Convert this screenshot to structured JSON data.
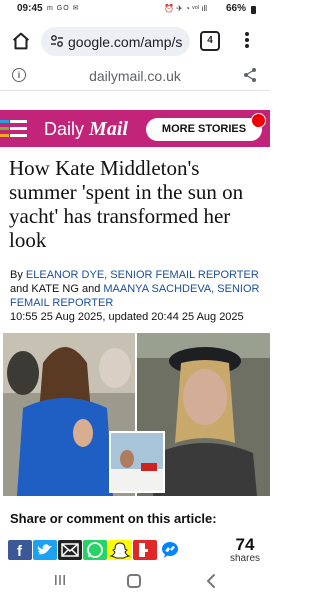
{
  "status": {
    "time": "09:45",
    "left_icons": "m GO ✉",
    "right_icons": "⏰ ✈ ◔ ᵛᵒˡ ıll",
    "battery": "66%"
  },
  "browser": {
    "url": "google.com/amp/s",
    "tab_count": "4",
    "amp_domain": "dailymail.co.uk"
  },
  "site": {
    "brand_daily": "Daily",
    "brand_mail": "Mail",
    "more_stories": "MORE STORIES",
    "brand_color": "#c2247a"
  },
  "article": {
    "headline": "How Kate Middleton's summer 'spent in the sun on yacht' has transformed her look",
    "by": "By",
    "author1": "ELEANOR DYE, SENIOR FEMAIL REPORTER",
    "and1": "and",
    "author2": "KATE NG",
    "and2": "and",
    "author3": "MAANYA SACHDEVA, SENIOR FEMAIL REPORTER",
    "timestamp": "10:55 25 Aug 2025, updated 20:44 25 Aug 2025"
  },
  "share": {
    "heading": "Share or comment on this article:",
    "count": "74",
    "count_label": "shares",
    "networks": [
      "facebook-icon",
      "twitter-icon",
      "email-icon",
      "whatsapp-icon",
      "snapchat-icon",
      "flipboard-icon",
      "messenger-icon"
    ]
  }
}
